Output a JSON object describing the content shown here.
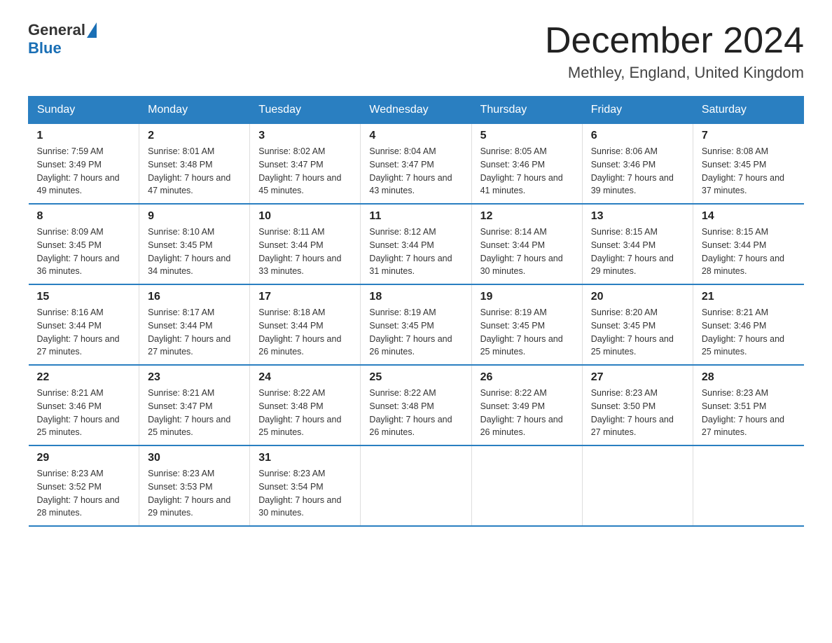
{
  "header": {
    "logo_general": "General",
    "logo_blue": "Blue",
    "month_title": "December 2024",
    "location": "Methley, England, United Kingdom"
  },
  "weekdays": [
    "Sunday",
    "Monday",
    "Tuesday",
    "Wednesday",
    "Thursday",
    "Friday",
    "Saturday"
  ],
  "weeks": [
    [
      {
        "day": "1",
        "sunrise": "Sunrise: 7:59 AM",
        "sunset": "Sunset: 3:49 PM",
        "daylight": "Daylight: 7 hours and 49 minutes."
      },
      {
        "day": "2",
        "sunrise": "Sunrise: 8:01 AM",
        "sunset": "Sunset: 3:48 PM",
        "daylight": "Daylight: 7 hours and 47 minutes."
      },
      {
        "day": "3",
        "sunrise": "Sunrise: 8:02 AM",
        "sunset": "Sunset: 3:47 PM",
        "daylight": "Daylight: 7 hours and 45 minutes."
      },
      {
        "day": "4",
        "sunrise": "Sunrise: 8:04 AM",
        "sunset": "Sunset: 3:47 PM",
        "daylight": "Daylight: 7 hours and 43 minutes."
      },
      {
        "day": "5",
        "sunrise": "Sunrise: 8:05 AM",
        "sunset": "Sunset: 3:46 PM",
        "daylight": "Daylight: 7 hours and 41 minutes."
      },
      {
        "day": "6",
        "sunrise": "Sunrise: 8:06 AM",
        "sunset": "Sunset: 3:46 PM",
        "daylight": "Daylight: 7 hours and 39 minutes."
      },
      {
        "day": "7",
        "sunrise": "Sunrise: 8:08 AM",
        "sunset": "Sunset: 3:45 PM",
        "daylight": "Daylight: 7 hours and 37 minutes."
      }
    ],
    [
      {
        "day": "8",
        "sunrise": "Sunrise: 8:09 AM",
        "sunset": "Sunset: 3:45 PM",
        "daylight": "Daylight: 7 hours and 36 minutes."
      },
      {
        "day": "9",
        "sunrise": "Sunrise: 8:10 AM",
        "sunset": "Sunset: 3:45 PM",
        "daylight": "Daylight: 7 hours and 34 minutes."
      },
      {
        "day": "10",
        "sunrise": "Sunrise: 8:11 AM",
        "sunset": "Sunset: 3:44 PM",
        "daylight": "Daylight: 7 hours and 33 minutes."
      },
      {
        "day": "11",
        "sunrise": "Sunrise: 8:12 AM",
        "sunset": "Sunset: 3:44 PM",
        "daylight": "Daylight: 7 hours and 31 minutes."
      },
      {
        "day": "12",
        "sunrise": "Sunrise: 8:14 AM",
        "sunset": "Sunset: 3:44 PM",
        "daylight": "Daylight: 7 hours and 30 minutes."
      },
      {
        "day": "13",
        "sunrise": "Sunrise: 8:15 AM",
        "sunset": "Sunset: 3:44 PM",
        "daylight": "Daylight: 7 hours and 29 minutes."
      },
      {
        "day": "14",
        "sunrise": "Sunrise: 8:15 AM",
        "sunset": "Sunset: 3:44 PM",
        "daylight": "Daylight: 7 hours and 28 minutes."
      }
    ],
    [
      {
        "day": "15",
        "sunrise": "Sunrise: 8:16 AM",
        "sunset": "Sunset: 3:44 PM",
        "daylight": "Daylight: 7 hours and 27 minutes."
      },
      {
        "day": "16",
        "sunrise": "Sunrise: 8:17 AM",
        "sunset": "Sunset: 3:44 PM",
        "daylight": "Daylight: 7 hours and 27 minutes."
      },
      {
        "day": "17",
        "sunrise": "Sunrise: 8:18 AM",
        "sunset": "Sunset: 3:44 PM",
        "daylight": "Daylight: 7 hours and 26 minutes."
      },
      {
        "day": "18",
        "sunrise": "Sunrise: 8:19 AM",
        "sunset": "Sunset: 3:45 PM",
        "daylight": "Daylight: 7 hours and 26 minutes."
      },
      {
        "day": "19",
        "sunrise": "Sunrise: 8:19 AM",
        "sunset": "Sunset: 3:45 PM",
        "daylight": "Daylight: 7 hours and 25 minutes."
      },
      {
        "day": "20",
        "sunrise": "Sunrise: 8:20 AM",
        "sunset": "Sunset: 3:45 PM",
        "daylight": "Daylight: 7 hours and 25 minutes."
      },
      {
        "day": "21",
        "sunrise": "Sunrise: 8:21 AM",
        "sunset": "Sunset: 3:46 PM",
        "daylight": "Daylight: 7 hours and 25 minutes."
      }
    ],
    [
      {
        "day": "22",
        "sunrise": "Sunrise: 8:21 AM",
        "sunset": "Sunset: 3:46 PM",
        "daylight": "Daylight: 7 hours and 25 minutes."
      },
      {
        "day": "23",
        "sunrise": "Sunrise: 8:21 AM",
        "sunset": "Sunset: 3:47 PM",
        "daylight": "Daylight: 7 hours and 25 minutes."
      },
      {
        "day": "24",
        "sunrise": "Sunrise: 8:22 AM",
        "sunset": "Sunset: 3:48 PM",
        "daylight": "Daylight: 7 hours and 25 minutes."
      },
      {
        "day": "25",
        "sunrise": "Sunrise: 8:22 AM",
        "sunset": "Sunset: 3:48 PM",
        "daylight": "Daylight: 7 hours and 26 minutes."
      },
      {
        "day": "26",
        "sunrise": "Sunrise: 8:22 AM",
        "sunset": "Sunset: 3:49 PM",
        "daylight": "Daylight: 7 hours and 26 minutes."
      },
      {
        "day": "27",
        "sunrise": "Sunrise: 8:23 AM",
        "sunset": "Sunset: 3:50 PM",
        "daylight": "Daylight: 7 hours and 27 minutes."
      },
      {
        "day": "28",
        "sunrise": "Sunrise: 8:23 AM",
        "sunset": "Sunset: 3:51 PM",
        "daylight": "Daylight: 7 hours and 27 minutes."
      }
    ],
    [
      {
        "day": "29",
        "sunrise": "Sunrise: 8:23 AM",
        "sunset": "Sunset: 3:52 PM",
        "daylight": "Daylight: 7 hours and 28 minutes."
      },
      {
        "day": "30",
        "sunrise": "Sunrise: 8:23 AM",
        "sunset": "Sunset: 3:53 PM",
        "daylight": "Daylight: 7 hours and 29 minutes."
      },
      {
        "day": "31",
        "sunrise": "Sunrise: 8:23 AM",
        "sunset": "Sunset: 3:54 PM",
        "daylight": "Daylight: 7 hours and 30 minutes."
      },
      null,
      null,
      null,
      null
    ]
  ]
}
